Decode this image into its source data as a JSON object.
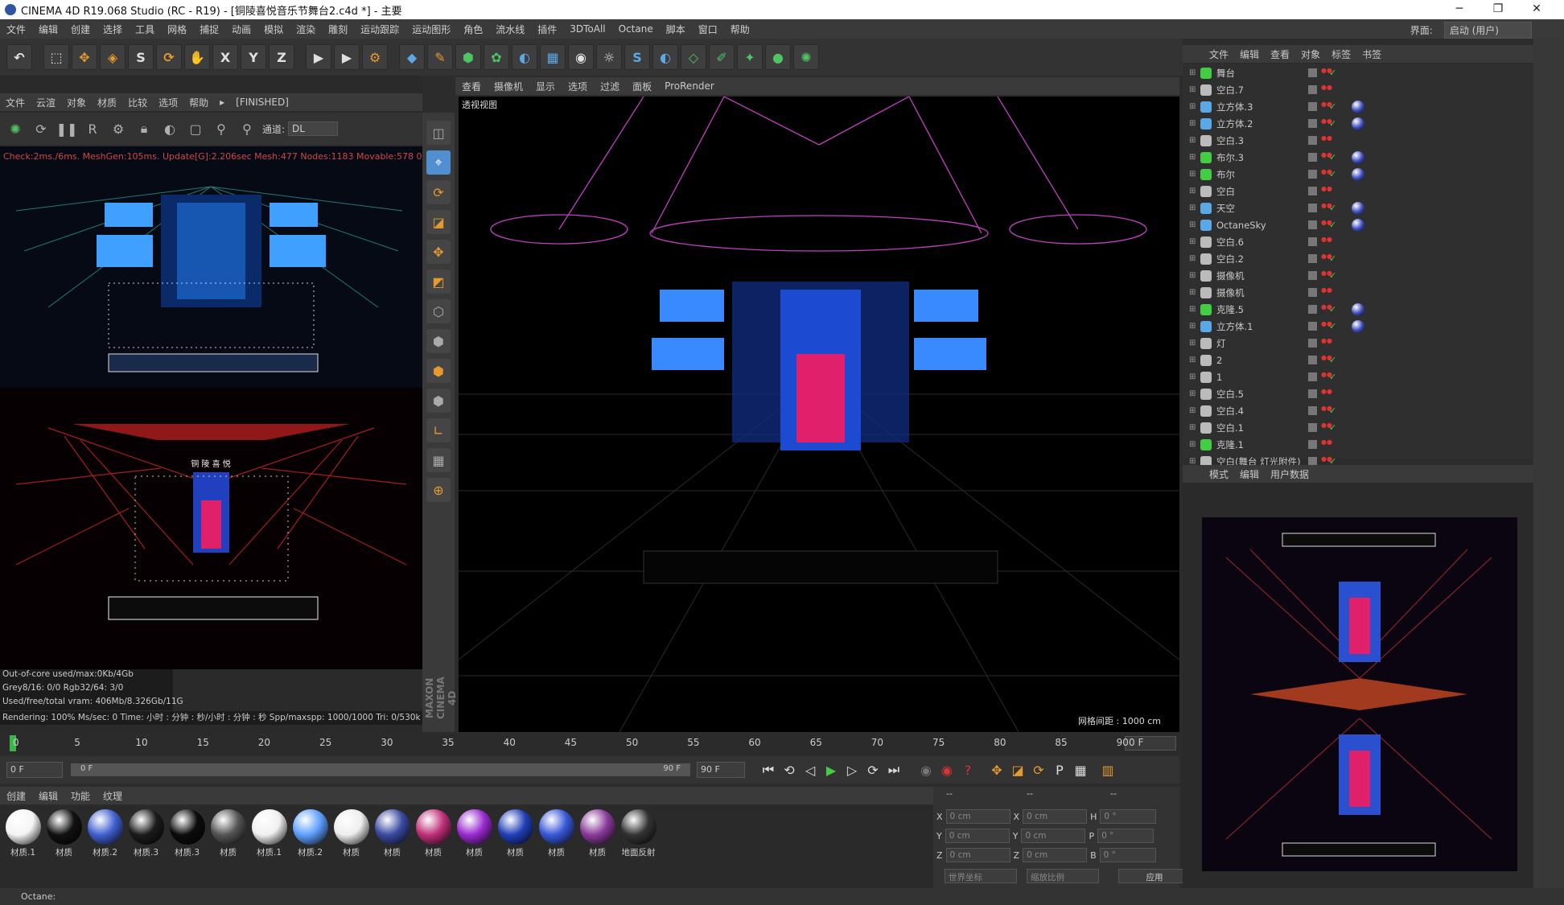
{
  "window": {
    "title": "CINEMA 4D R19.068 Studio (RC - R19) - [铜陵喜悦音乐节舞台2.c4d *] - 主要",
    "minimize": "─",
    "maximize": "❐",
    "close": "✕"
  },
  "menubar": {
    "items": [
      "文件",
      "编辑",
      "创建",
      "选择",
      "工具",
      "网格",
      "捕捉",
      "动画",
      "模拟",
      "渲染",
      "雕刻",
      "运动跟踪",
      "运动图形",
      "角色",
      "流水线",
      "插件",
      "3DToAll",
      "Octane",
      "脚本",
      "窗口",
      "帮助"
    ],
    "layout_label": "界面:",
    "layout_value": "启动 (用户)"
  },
  "toolbar": {
    "icons": [
      [
        "undo-icon",
        "↶",
        ""
      ],
      [
        "live-select-icon",
        "⬚",
        ""
      ],
      [
        "move-icon",
        "✥",
        "o"
      ],
      [
        "scale-icon",
        "◈",
        "o"
      ],
      [
        "s-icon",
        "S",
        ""
      ],
      [
        "rotate-icon",
        "⟳",
        "o"
      ],
      [
        "coord-icon",
        "✋",
        ""
      ],
      [
        "x-axis-icon",
        "X",
        ""
      ],
      [
        "y-axis-icon",
        "Y",
        ""
      ],
      [
        "z-axis-icon",
        "Z",
        ""
      ],
      [
        "render-view-icon",
        "▶",
        ""
      ],
      [
        "render-icon",
        "▶",
        ""
      ],
      [
        "render-settings-icon",
        "⚙",
        "o"
      ],
      [
        "cube-icon",
        "◆",
        "b"
      ],
      [
        "pen-icon",
        "✎",
        "o"
      ],
      [
        "subdivision-icon",
        "⬢",
        "g"
      ],
      [
        "cloner-icon",
        "✿",
        "g"
      ],
      [
        "deformer-icon",
        "◐",
        "b"
      ],
      [
        "floor-icon",
        "▦",
        "b"
      ],
      [
        "camera-icon",
        "◉",
        ""
      ],
      [
        "light-icon",
        "☼",
        ""
      ],
      [
        "octane-icon",
        "S",
        "b"
      ],
      [
        "octane-live-icon",
        "◐",
        "b"
      ],
      [
        "octane-obj-icon",
        "◇",
        "g"
      ],
      [
        "octane-lights-icon",
        "✐",
        "g"
      ],
      [
        "octane-camera-icon",
        "✦",
        "g"
      ],
      [
        "octane-tex-icon",
        "●",
        "g"
      ],
      [
        "octane-settings-icon",
        "✺",
        "g"
      ]
    ]
  },
  "left_panel": {
    "menu": [
      "文件",
      "云渲",
      "对象",
      "材质",
      "比较",
      "选项",
      "帮助",
      "▸",
      "[FINISHED]"
    ],
    "channel_label": "通道:",
    "channel_value": "DL",
    "status": "Check:2ms./6ms. MeshGen:105ms. Update[G]:2.206sec Mesh:477 Nodes:1183 Movable:578  0 0",
    "info1": "Out-of-core used/max:0Kb/4Gb",
    "info2": "Grey8/16: 0/0        Rgb32/64: 3/0",
    "info3": "Used/free/total vram: 406Mb/8.326Gb/11G",
    "info4": "Rendering: 100%   Ms/sec: 0   Time: 小时 : 分钟 : 秒/小时 : 分钟 : 秒   Spp/maxspp: 1000/1000   Tri: 0/530k",
    "stage_text": "铜 陵 喜 悦",
    "maxon_label": "MAXON CINEMA 4D"
  },
  "viewport": {
    "menu": [
      "查看",
      "摄像机",
      "显示",
      "选项",
      "过滤",
      "面板",
      "ProRender"
    ],
    "label": "透视视图",
    "grid": "网格间距 : 1000 cm"
  },
  "timeline": {
    "ticks": [
      "0",
      "5",
      "10",
      "15",
      "20",
      "25",
      "30",
      "35",
      "40",
      "45",
      "50",
      "55",
      "60",
      "65",
      "70",
      "75",
      "80",
      "85",
      "90"
    ],
    "frame": "0 F",
    "start": "0 F",
    "range_start": "0 F",
    "range_end": "90 F",
    "end": "90 F"
  },
  "materials": {
    "menu": [
      "创建",
      "编辑",
      "功能",
      "纹理"
    ],
    "items": [
      [
        "材质.1",
        "#f4f4f4"
      ],
      [
        "材质",
        "#111"
      ],
      [
        "材质.2",
        "#4060d0"
      ],
      [
        "材质.3",
        "#1c1c1c"
      ],
      [
        "材质.3",
        "#0c0c0c"
      ],
      [
        "材质",
        "#555"
      ],
      [
        "材质.1",
        "#f0f0f0"
      ],
      [
        "材质.2",
        "#5ea0ff"
      ],
      [
        "材质",
        "#eeeeee"
      ],
      [
        "材质",
        "#3a4aa0"
      ],
      [
        "材质",
        "#c0307a"
      ],
      [
        "材质",
        "#9a2ad0"
      ],
      [
        "材质",
        "#2040b8"
      ],
      [
        "材质",
        "#3858d8"
      ],
      [
        "材质",
        "#8a3a9a"
      ],
      [
        "地面反射",
        "#333"
      ]
    ]
  },
  "coords": {
    "x": "X",
    "y": "Y",
    "z": "Z",
    "pos_x": "0 cm",
    "pos_y": "0 cm",
    "pos_z": "0 cm",
    "size_x": "0 cm",
    "size_y": "0 cm",
    "size_z": "0 cm",
    "h": "H",
    "p": "P",
    "b": "B",
    "rot_h": "0 °",
    "rot_p": "0 °",
    "rot_b": "0 °",
    "world": "世界坐标",
    "scale": "缩放比例",
    "apply": "应用",
    "dash1": "--",
    "dash2": "--",
    "dash3": "--"
  },
  "status": "Octane:",
  "objects": {
    "menu": [
      "文件",
      "编辑",
      "查看",
      "对象",
      "标签",
      "书签"
    ],
    "rows": [
      [
        "舞台",
        "#4c4"
      ],
      [
        "空白.7",
        "#bbb"
      ],
      [
        "立方体.3",
        "#5aa8e6"
      ],
      [
        "立方体.2",
        "#5aa8e6"
      ],
      [
        "空白.3",
        "#bbb"
      ],
      [
        "布尔.3",
        "#4c4"
      ],
      [
        "布尔",
        "#4c4"
      ],
      [
        "空白",
        "#bbb"
      ],
      [
        "天空",
        "#5aa8e6"
      ],
      [
        "OctaneSky",
        "#5aa8e6"
      ],
      [
        "空白.6",
        "#bbb"
      ],
      [
        "空白.2",
        "#bbb"
      ],
      [
        "摄像机",
        "#bbb"
      ],
      [
        "摄像机",
        "#bbb"
      ],
      [
        "克隆.5",
        "#4c4"
      ],
      [
        "立方体.1",
        "#5aa8e6"
      ],
      [
        "灯",
        "#bbb"
      ],
      [
        "2",
        "#bbb"
      ],
      [
        "1",
        "#bbb"
      ],
      [
        "空白.5",
        "#bbb"
      ],
      [
        "空白.4",
        "#bbb"
      ],
      [
        "空白.1",
        "#bbb"
      ],
      [
        "克隆.1",
        "#4c4"
      ],
      [
        "空白(舞台 灯光附件)",
        "#bbb"
      ]
    ]
  },
  "attributes": {
    "menu": [
      "模式",
      "编辑",
      "用户数据"
    ]
  }
}
